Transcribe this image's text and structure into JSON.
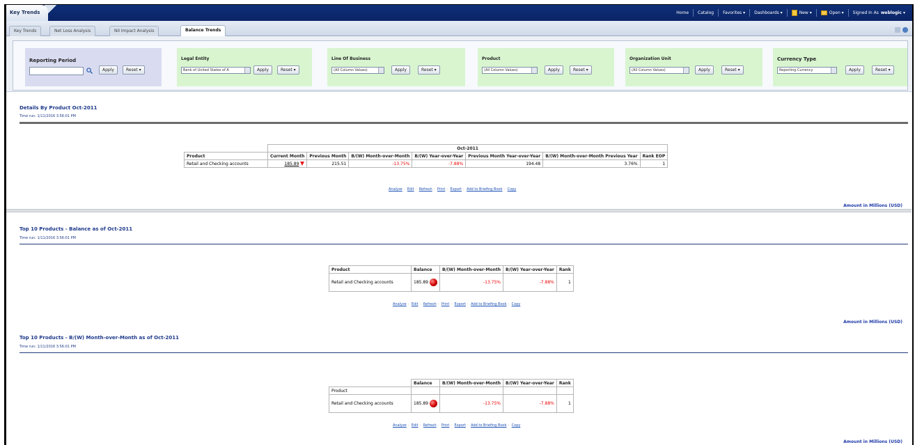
{
  "app": {
    "title": "Key Trends"
  },
  "topnav": {
    "home": "Home",
    "catalog": "Catalog",
    "favorites": "Favorites ▾",
    "dashboards": "Dashboards ▾",
    "new": "New ▾",
    "open": "Open ▾",
    "signed_in_as": "Signed In As",
    "user": "weblogic ▾"
  },
  "tabs": [
    {
      "label": "Key Trends"
    },
    {
      "label": "Net Loss Analysis"
    },
    {
      "label": "NII Impact Analysis"
    },
    {
      "label": "Balance Trends"
    }
  ],
  "prompts": {
    "reporting_period": {
      "label": "Reporting Period",
      "apply": "Apply",
      "reset": "Reset ▾"
    },
    "legal_entity": {
      "label": "Legal Entity",
      "value": "Bank of United States of A",
      "apply": "Apply",
      "reset": "Reset ▾"
    },
    "line_of_business": {
      "label": "Line Of Business",
      "value": "(All Column Values)",
      "apply": "Apply",
      "reset": "Reset ▾"
    },
    "product": {
      "label": "Product",
      "value": "(All Column Values)",
      "apply": "Apply",
      "reset": "Reset ▾"
    },
    "org_unit": {
      "label": "Organization Unit",
      "value": "(All Column Values)",
      "apply": "Apply",
      "reset": "Reset ▾"
    },
    "currency_type": {
      "label": "Currency Type",
      "value": "Reporting Currency",
      "apply": "Apply",
      "reset": "Reset ▾"
    }
  },
  "links": {
    "analyze": "Analyze",
    "edit": "Edit",
    "refresh": "Refresh",
    "print": "Print",
    "export": "Export",
    "add_briefing": "Add to Briefing Book",
    "copy": "Copy",
    "sep": "·"
  },
  "units": "Amount in Millions (USD)",
  "section1": {
    "title": "Details By Product Oct-2011",
    "time_run": "Time run: 1/11/2016 3:56:01 PM",
    "period": "Oct-2011",
    "headers": {
      "product": "Product",
      "current_month": "Current Month",
      "previous_month": "Previous Month",
      "bw_mom": "B/(W) Month-over-Month",
      "bw_yoy": "B/(W) Year-over-Year",
      "prev_month_yoy": "Previous Month Year-over-Year",
      "bw_mom_prev_year": "B/(W) Month-over-Month Previous Year",
      "rank_eop": "Rank EOP"
    },
    "row": {
      "product": "Retail and Checking accounts",
      "current_month": "185.89",
      "previous_month": "215.51",
      "bw_mom": "-13.75%",
      "bw_yoy": "-7.88%",
      "prev_month_yoy": "194.48",
      "bw_mom_prev_year": "3.76%",
      "rank_eop": "1"
    }
  },
  "section2": {
    "title": "Top 10 Products - Balance as of Oct-2011",
    "time_run": "Time run: 1/11/2016 3:56:01 PM",
    "headers": {
      "product": "Product",
      "balance": "Balance",
      "bw_mom": "B/(W) Month-over-Month",
      "bw_yoy": "B/(W) Year-over-Year",
      "rank": "Rank"
    },
    "row": {
      "product": "Retail and Checking accounts",
      "balance": "185.89",
      "bw_mom": "-13.75%",
      "bw_yoy": "-7.88%",
      "rank": "1"
    }
  },
  "section3": {
    "title": "Top 10 Products - B/(W) Month-over-Month as of Oct-2011",
    "time_run": "Time run: 1/11/2016 3:56:01 PM",
    "headers": {
      "product": "Product",
      "balance": "Balance",
      "bw_mom": "B/(W) Month-over-Month",
      "bw_yoy": "B/(W) Year-over-Year",
      "rank": "Rank"
    },
    "row": {
      "product": "Retail and Checking accounts",
      "balance": "185.89",
      "bw_mom": "-13.75%",
      "bw_yoy": "-7.88%",
      "rank": "1"
    }
  },
  "colors": {
    "nav_bg": "#0a2466",
    "title_blue": "#1e3a8a",
    "negative": "#e00000",
    "prompt_green": "#d8f5d0",
    "prompt_blue": "#d9dcf1"
  }
}
